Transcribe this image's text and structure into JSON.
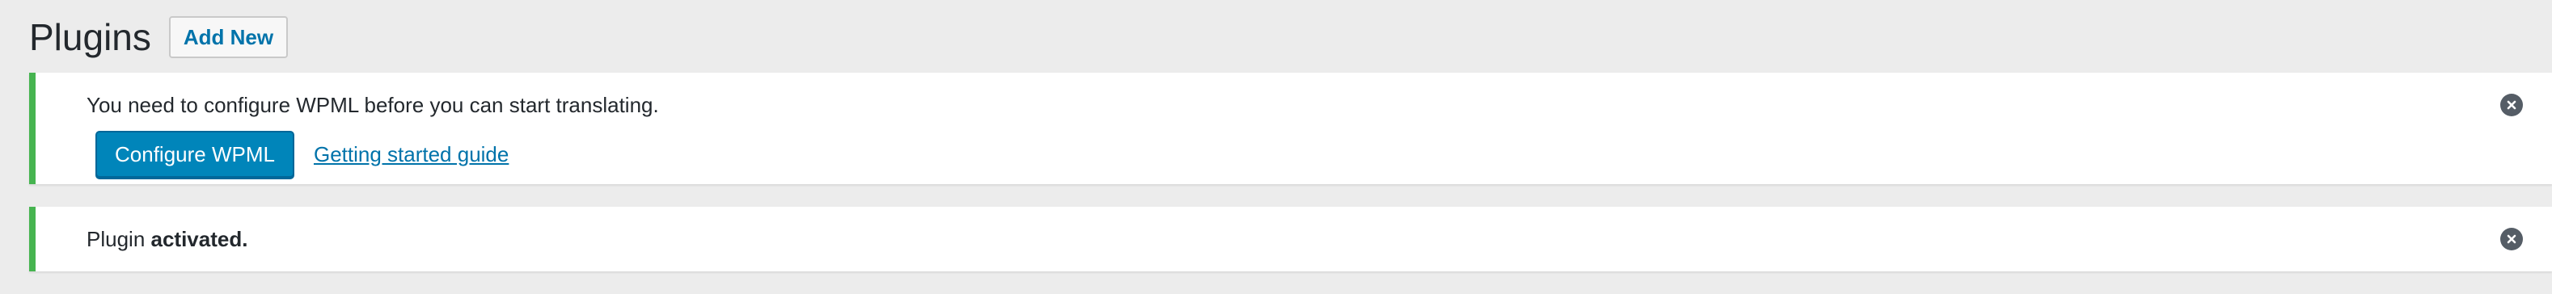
{
  "header": {
    "title": "Plugins",
    "add_new_label": "Add New"
  },
  "notices": {
    "wpml": {
      "message": "You need to configure WPML before you can start translating.",
      "configure_label": "Configure WPML",
      "guide_label": "Getting started guide",
      "dismiss_icon": "close-circle-icon"
    },
    "activated": {
      "message_prefix": "Plugin ",
      "message_bold": "activated.",
      "dismiss_icon": "close-circle-icon"
    }
  },
  "colors": {
    "background": "#ececec",
    "notice_border_success": "#46b450",
    "primary_button": "#0085ba",
    "link": "#0073aa"
  }
}
